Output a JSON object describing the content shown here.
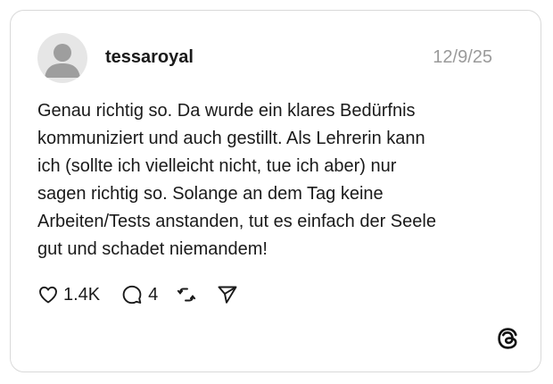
{
  "post": {
    "username": "tessaroyal",
    "timestamp": "12/9/25",
    "text": "Genau richtig so. Da wurde ein klares Bedürfnis\nkommuniziert und auch gestillt. Als Lehrerin kann\nich (sollte ich vielleicht nicht, tue ich aber) nur\nsagen richtig so. Solange an dem Tag keine\nArbeiten/Tests anstanden, tut es einfach der Seele\ngut und schadet niemandem!"
  },
  "actions": {
    "likes": "1.4K",
    "replies": "4"
  },
  "icons": {
    "like": "heart-icon",
    "reply": "comment-bubble-icon",
    "repost": "repost-icon",
    "share": "send-icon",
    "brand": "threads-logo-icon",
    "avatar": "default-avatar-icon"
  },
  "colors": {
    "text": "#1a1a1a",
    "muted": "#9a9a9a",
    "border": "#d9d9d9",
    "avatar_bg": "#e6e6e6",
    "avatar_fg": "#9e9e9e"
  }
}
